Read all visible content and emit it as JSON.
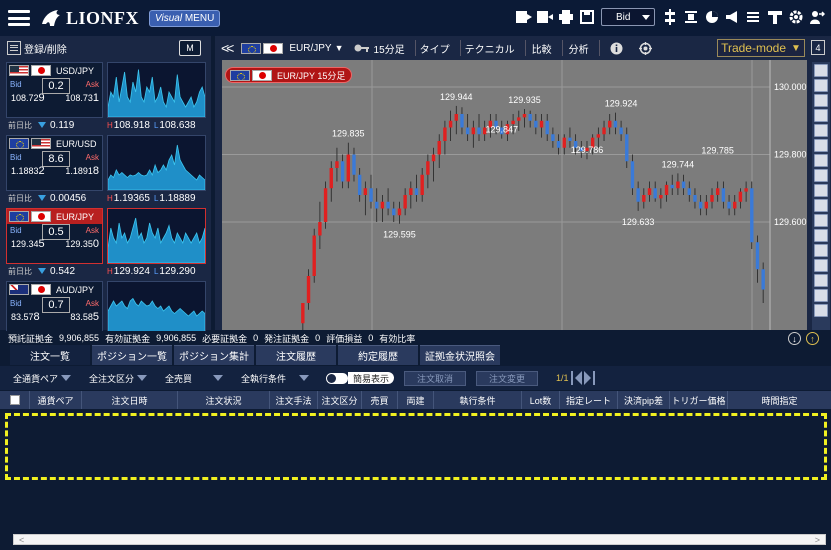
{
  "header": {
    "logo": "LIONFX",
    "visual_menu_a": "Visual",
    "visual_menu_b": " MENU",
    "price_type": "Bid"
  },
  "left_panel": {
    "register_label": "登録/削除",
    "m_button": "M",
    "change_label": "前日比",
    "pairs": [
      {
        "symbol": "USD/JPY",
        "spread": "0.2",
        "bid_lbl": "Bid",
        "ask_lbl": "Ask",
        "bid_a": "108.72",
        "bid_b": "9",
        "ask_a": "108.73",
        "ask_b": "1",
        "change": "0.119",
        "high": "108.918",
        "low": "108.638",
        "spark": [
          0.2,
          0.5,
          0.4,
          0.8,
          0.3,
          0.6,
          0.9,
          0.4,
          0.3,
          0.7,
          0.5,
          0.95,
          0.4,
          0.3,
          0.6,
          0.5,
          0.8,
          0.3,
          0.4,
          0.6,
          0.3,
          0.2,
          0.5,
          0.4,
          0.3,
          0.85,
          0.4,
          0.3,
          0.2,
          0.3,
          0.4,
          0.2,
          0.3,
          0.5,
          0.6,
          0.4
        ]
      },
      {
        "symbol": "EUR/USD",
        "spread": "8.6",
        "bid_lbl": "Bid",
        "ask_lbl": "Ask",
        "bid_a": "1.1883",
        "bid_b": "2",
        "ask_a": "1.1891",
        "ask_b": "8",
        "change": "0.00456",
        "high": "1.19365",
        "low": "1.18889",
        "spark": [
          0.2,
          0.3,
          0.25,
          0.4,
          0.3,
          0.35,
          0.3,
          0.25,
          0.3,
          0.28,
          0.3,
          0.35,
          0.3,
          0.28,
          0.3,
          0.4,
          0.3,
          0.5,
          0.35,
          0.4,
          0.5,
          0.4,
          0.6,
          0.7,
          0.5,
          0.9,
          0.6,
          0.5,
          0.4,
          0.35,
          0.3,
          0.25,
          0.2,
          0.3,
          0.25,
          0.2
        ]
      },
      {
        "symbol": "EUR/JPY",
        "spread": "0.5",
        "bid_lbl": "Bid",
        "ask_lbl": "Ask",
        "bid_a": "129.34",
        "bid_b": "5",
        "ask_a": "129.35",
        "ask_b": "0",
        "change": "0.542",
        "high": "129.924",
        "low": "129.290",
        "spark": [
          0.3,
          0.7,
          0.5,
          0.4,
          0.8,
          0.5,
          0.6,
          0.4,
          0.5,
          0.7,
          0.9,
          0.5,
          0.6,
          0.4,
          0.5,
          0.8,
          0.6,
          0.5,
          0.7,
          0.4,
          0.5,
          0.6,
          0.75,
          0.5,
          0.4,
          0.6,
          0.5,
          0.4,
          0.6,
          0.5,
          0.4,
          0.5,
          0.6,
          0.4,
          0.5,
          0.7
        ]
      },
      {
        "symbol": "AUD/JPY",
        "spread": "0.7",
        "bid_lbl": "Bid",
        "ask_lbl": "Ask",
        "bid_a": "83.57",
        "bid_b": "8",
        "ask_a": "83.58",
        "ask_b": "5",
        "change": "",
        "high": "",
        "low": "",
        "spark": [
          0.5,
          0.6,
          0.7,
          0.6,
          0.65,
          0.7,
          0.6,
          0.55,
          0.7,
          0.75,
          0.65,
          0.6,
          0.7,
          0.65,
          0.6,
          0.62,
          0.7,
          0.6,
          0.55,
          0.6,
          0.5,
          0.55,
          0.6,
          0.5,
          0.45,
          0.5,
          0.55,
          0.5,
          0.45,
          0.4,
          0.45,
          0.5,
          0.4,
          0.45,
          0.5,
          0.45
        ]
      }
    ]
  },
  "chart_toolbar": {
    "pair": "EUR/JPY",
    "interval": "15分足",
    "type": "タイプ",
    "technical": "テクニカル",
    "compare": "比較",
    "analysis": "分析",
    "trade_mode": "Trade-mode",
    "panel_count": "4"
  },
  "chart_label": "EUR/JPY 15分足",
  "chart_data": {
    "type": "candlestick",
    "title": "EUR/JPY 15分足",
    "ylim": [
      129.28,
      130.08
    ],
    "y_ticks": [
      "130.000",
      "129.800",
      "129.600"
    ],
    "y_tick_values": [
      130.0,
      129.8,
      129.6
    ],
    "annotations": [
      {
        "label": "129.835",
        "x_index": 8,
        "value": 129.835
      },
      {
        "label": "129.595",
        "x_index": 17,
        "value": 129.595
      },
      {
        "label": "129.944",
        "x_index": 27,
        "value": 129.944
      },
      {
        "label": "129.847",
        "x_index": 35,
        "value": 129.847
      },
      {
        "label": "129.935",
        "x_index": 39,
        "value": 129.935
      },
      {
        "label": "129.786",
        "x_index": 50,
        "value": 129.786
      },
      {
        "label": "129.924",
        "x_index": 56,
        "value": 129.924
      },
      {
        "label": "129.633",
        "x_index": 59,
        "value": 129.633
      },
      {
        "label": "129.744",
        "x_index": 66,
        "value": 129.744
      },
      {
        "label": "129.785",
        "x_index": 73,
        "value": 129.785
      }
    ],
    "candles": [
      [
        129.3,
        129.36,
        129.28,
        129.36
      ],
      [
        129.36,
        129.46,
        129.34,
        129.44
      ],
      [
        129.44,
        129.58,
        129.42,
        129.56
      ],
      [
        129.56,
        129.66,
        129.52,
        129.6
      ],
      [
        129.6,
        129.72,
        129.58,
        129.7
      ],
      [
        129.7,
        129.78,
        129.66,
        129.76
      ],
      [
        129.76,
        129.82,
        129.72,
        129.78
      ],
      [
        129.78,
        129.8,
        129.7,
        129.72
      ],
      [
        129.72,
        129.835,
        129.7,
        129.8
      ],
      [
        129.8,
        129.82,
        129.72,
        129.74
      ],
      [
        129.74,
        129.76,
        129.66,
        129.68
      ],
      [
        129.68,
        129.72,
        129.62,
        129.7
      ],
      [
        129.7,
        129.74,
        129.64,
        129.66
      ],
      [
        129.66,
        129.7,
        129.6,
        129.64
      ],
      [
        129.64,
        129.68,
        129.6,
        129.66
      ],
      [
        129.66,
        129.7,
        129.62,
        129.64
      ],
      [
        129.64,
        129.66,
        129.6,
        129.62
      ],
      [
        129.62,
        129.66,
        129.595,
        129.64
      ],
      [
        129.64,
        129.7,
        129.62,
        129.68
      ],
      [
        129.68,
        129.72,
        129.64,
        129.7
      ],
      [
        129.7,
        129.74,
        129.66,
        129.68
      ],
      [
        129.68,
        129.76,
        129.66,
        129.74
      ],
      [
        129.74,
        129.8,
        129.7,
        129.78
      ],
      [
        129.78,
        129.82,
        129.72,
        129.8
      ],
      [
        129.8,
        129.86,
        129.76,
        129.84
      ],
      [
        129.84,
        129.9,
        129.8,
        129.88
      ],
      [
        129.88,
        129.93,
        129.84,
        129.9
      ],
      [
        129.9,
        129.944,
        129.86,
        129.92
      ],
      [
        129.92,
        129.94,
        129.86,
        129.88
      ],
      [
        129.88,
        129.92,
        129.84,
        129.86
      ],
      [
        129.86,
        129.9,
        129.82,
        129.88
      ],
      [
        129.88,
        129.92,
        129.84,
        129.86
      ],
      [
        129.86,
        129.9,
        129.84,
        129.88
      ],
      [
        129.88,
        129.92,
        129.85,
        129.9
      ],
      [
        129.9,
        129.92,
        129.86,
        129.88
      ],
      [
        129.88,
        129.9,
        129.847,
        129.86
      ],
      [
        129.86,
        129.9,
        129.84,
        129.89
      ],
      [
        129.89,
        129.92,
        129.86,
        129.9
      ],
      [
        129.9,
        129.93,
        129.87,
        129.91
      ],
      [
        129.91,
        129.935,
        129.88,
        129.92
      ],
      [
        129.92,
        129.93,
        129.88,
        129.9
      ],
      [
        129.9,
        129.92,
        129.86,
        129.88
      ],
      [
        129.88,
        129.92,
        129.85,
        129.9
      ],
      [
        129.9,
        129.92,
        129.84,
        129.86
      ],
      [
        129.86,
        129.88,
        129.82,
        129.84
      ],
      [
        129.84,
        129.86,
        129.8,
        129.82
      ],
      [
        129.82,
        129.86,
        129.8,
        129.85
      ],
      [
        129.85,
        129.88,
        129.82,
        129.84
      ],
      [
        129.84,
        129.86,
        129.8,
        129.82
      ],
      [
        129.82,
        129.84,
        129.79,
        129.81
      ],
      [
        129.81,
        129.84,
        129.786,
        129.82
      ],
      [
        129.82,
        129.86,
        129.8,
        129.85
      ],
      [
        129.85,
        129.88,
        129.82,
        129.86
      ],
      [
        129.86,
        129.9,
        129.84,
        129.88
      ],
      [
        129.88,
        129.92,
        129.86,
        129.9
      ],
      [
        129.9,
        129.924,
        129.86,
        129.88
      ],
      [
        129.88,
        129.9,
        129.84,
        129.86
      ],
      [
        129.86,
        129.88,
        129.76,
        129.78
      ],
      [
        129.78,
        129.8,
        129.68,
        129.7
      ],
      [
        129.7,
        129.72,
        129.633,
        129.66
      ],
      [
        129.66,
        129.7,
        129.64,
        129.68
      ],
      [
        129.68,
        129.72,
        129.66,
        129.7
      ],
      [
        129.7,
        129.72,
        129.66,
        129.67
      ],
      [
        129.67,
        129.7,
        129.64,
        129.68
      ],
      [
        129.68,
        129.72,
        129.66,
        129.71
      ],
      [
        129.71,
        129.74,
        129.68,
        129.7
      ],
      [
        129.7,
        129.744,
        129.68,
        129.72
      ],
      [
        129.72,
        129.74,
        129.68,
        129.7
      ],
      [
        129.7,
        129.72,
        129.66,
        129.68
      ],
      [
        129.68,
        129.7,
        129.64,
        129.66
      ],
      [
        129.66,
        129.68,
        129.62,
        129.64
      ],
      [
        129.64,
        129.68,
        129.62,
        129.66
      ],
      [
        129.66,
        129.7,
        129.64,
        129.68
      ],
      [
        129.68,
        129.72,
        129.66,
        129.7
      ],
      [
        129.7,
        129.72,
        129.64,
        129.66
      ],
      [
        129.66,
        129.68,
        129.62,
        129.64
      ],
      [
        129.64,
        129.68,
        129.62,
        129.66
      ],
      [
        129.66,
        129.7,
        129.64,
        129.69
      ],
      [
        129.69,
        129.72,
        129.66,
        129.7
      ],
      [
        129.7,
        129.72,
        129.52,
        129.54
      ],
      [
        129.54,
        129.56,
        129.42,
        129.46
      ],
      [
        129.46,
        129.48,
        129.36,
        129.4
      ]
    ]
  },
  "account": {
    "items": [
      {
        "label": "預託証拠金",
        "value": "9,906,855"
      },
      {
        "label": "有効証拠金",
        "value": "9,906,855"
      },
      {
        "label": "必要証拠金",
        "value": "0"
      },
      {
        "label": "発注証拠金",
        "value": "0"
      },
      {
        "label": "評価損益",
        "value": "0"
      },
      {
        "label": "有効比率",
        "value": ""
      }
    ]
  },
  "tabs": [
    "注文一覧",
    "ポジション一覧",
    "ポジション集計",
    "注文履歴",
    "約定履歴",
    "証拠金状況照会"
  ],
  "filters": {
    "pair": "全通貨ペア",
    "order_type": "全注文区分",
    "side": "全売買",
    "condition": "全執行条件",
    "simple_display": "簡易表示",
    "cancel_btn": "注文取消",
    "change_btn": "注文変更",
    "page": "1/1"
  },
  "table_columns": [
    "通貨ペア",
    "注文日時",
    "注文状況",
    "注文手法",
    "注文区分",
    "売買",
    "両建",
    "執行条件",
    "Lot数",
    "指定レート",
    "決済pip差",
    "トリガー価格",
    "時間指定"
  ]
}
